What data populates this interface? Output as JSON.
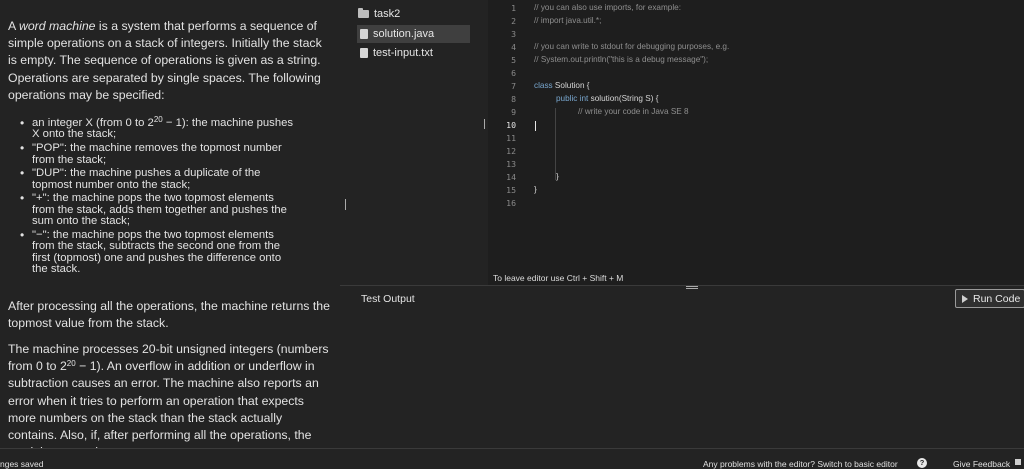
{
  "task": {
    "p1_em": "word machine",
    "p1_a": "A ",
    "p1_b": " is a system that performs a sequence of simple operations on a stack of integers. Initially the stack is empty. The sequence of operations is given as a string. Operations are separated by single spaces. The following operations may be specified:",
    "bullets": [
      {
        "pre": "an integer X (from 0 to 2",
        "sup": "20",
        "post": " − 1): the machine pushes X onto the stack;"
      },
      {
        "pre": "\"POP\": the machine removes the topmost number from the stack;"
      },
      {
        "pre": "\"DUP\": the machine pushes a duplicate of the topmost number onto the stack;"
      },
      {
        "pre": "\"+\": the machine pops the two topmost elements from the stack, adds them together and pushes the sum onto the stack;"
      },
      {
        "pre": "\"−\": the machine pops the two topmost elements from the stack, subtracts the second one from the first (topmost) one and pushes the difference onto the stack."
      }
    ],
    "p2": "After processing all the operations, the machine returns the topmost value from the stack.",
    "p3_pre": "The machine processes 20-bit unsigned integers (numbers from 0 to 2",
    "p3_sup": "20",
    "p3_post": " − 1). An overflow in addition or underflow in subtraction causes an error. The machine also reports an error when it tries to perform an operation that expects more numbers on the stack than the stack actually contains. Also, if, after performing all the operations, the stack is empty, the"
  },
  "tree": {
    "folder": "task2",
    "files": [
      "solution.java",
      "test-input.txt"
    ]
  },
  "editor": {
    "line_numbers": [
      "1",
      "2",
      "3",
      "4",
      "5",
      "6",
      "7",
      "8",
      "9",
      "10",
      "11",
      "12",
      "13",
      "14",
      "15",
      "16"
    ],
    "lines": {
      "l1": "// you can also use imports, for example:",
      "l2": "// import java.util.*;",
      "l4": "// you can write to stdout for debugging purposes, e.g.",
      "l5": "// System.out.println(\"this is a debug message\");",
      "l7_kw": "class",
      "l7_rest": " Solution {",
      "l8_kw1": "public",
      "l8_kw2": "int",
      "l8_rest": " solution(String S) {",
      "l9": "// write your code in Java SE 8",
      "l14": "}",
      "l15": "}"
    },
    "hint": "To leave editor use Ctrl + Shift + M"
  },
  "output": {
    "title": "Test Output",
    "run_label": "Run Code"
  },
  "status": {
    "saved": "nges saved",
    "problems": "Any problems with the editor? Switch to basic editor",
    "feedback": "Give Feedback"
  }
}
